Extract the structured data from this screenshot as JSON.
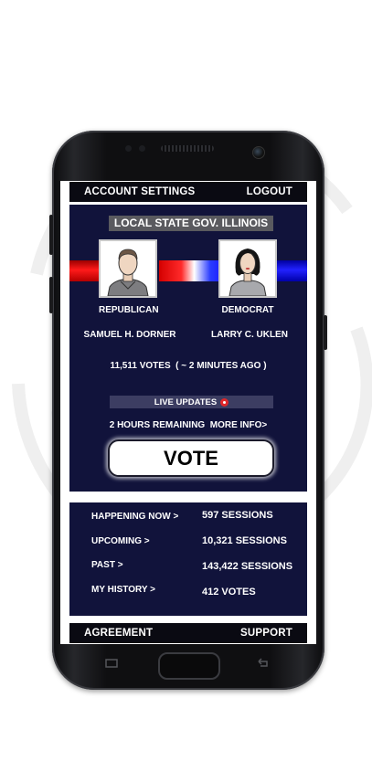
{
  "topbar": {
    "account_settings": "ACCOUNT SETTINGS",
    "logout": "LOGOUT"
  },
  "election": {
    "title": "LOCAL STATE GOV. ILLINOIS"
  },
  "candidates": [
    {
      "party": "REPUBLICAN",
      "name": "SAMUEL H. DORNER",
      "color": "#e00000"
    },
    {
      "party": "DEMOCRAT",
      "name": "LARRY C. UKLEN",
      "color": "#1a1aff"
    }
  ],
  "votes_line": "11,511 VOTES  ( ~ 2 MINUTES AGO )",
  "live_updates": "LIVE UPDATES",
  "remaining": {
    "time_left": "2 HOURS REMAINING",
    "more_info": "MORE INFO>"
  },
  "vote_button": "VOTE",
  "stats": [
    {
      "label": "HAPPENING NOW >",
      "value": "597 SESSIONS"
    },
    {
      "label": "UPCOMING >",
      "value": "10,321 SESSIONS"
    },
    {
      "label": "PAST >",
      "value": "143,422 SESSIONS"
    },
    {
      "label": "MY HISTORY >",
      "value": "412 VOTES"
    }
  ],
  "bottombar": {
    "agreement": "AGREEMENT",
    "support": "SUPPORT"
  },
  "colors": {
    "panel": "#11133b",
    "accent_red": "#e0282a",
    "bar": "#0a0a12"
  },
  "icons": [
    "republican-avatar-icon",
    "democrat-avatar-icon",
    "live-dot-icon",
    "recent-apps-icon",
    "back-icon"
  ]
}
